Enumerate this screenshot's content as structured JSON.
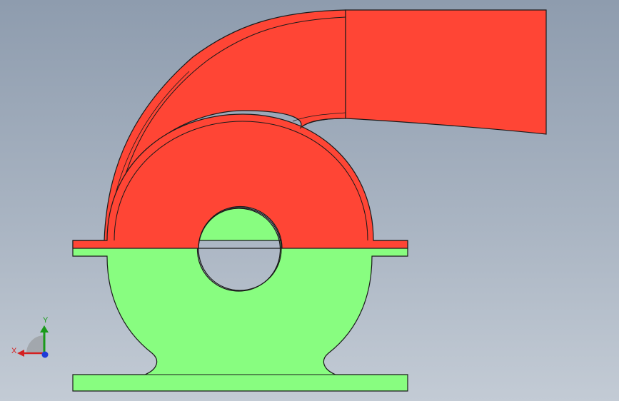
{
  "viewport": {
    "background_top": "#8e9cae",
    "background_bottom": "#c3cbd5"
  },
  "model": {
    "volute_color": "#ff4535",
    "base_color": "#88fd80",
    "edge_color": "#1a1a1a"
  },
  "triad": {
    "x_label": "X",
    "y_label": "Y",
    "x_color": "#d42020",
    "y_color": "#1a9a1a",
    "z_color": "#1e3cd8"
  }
}
